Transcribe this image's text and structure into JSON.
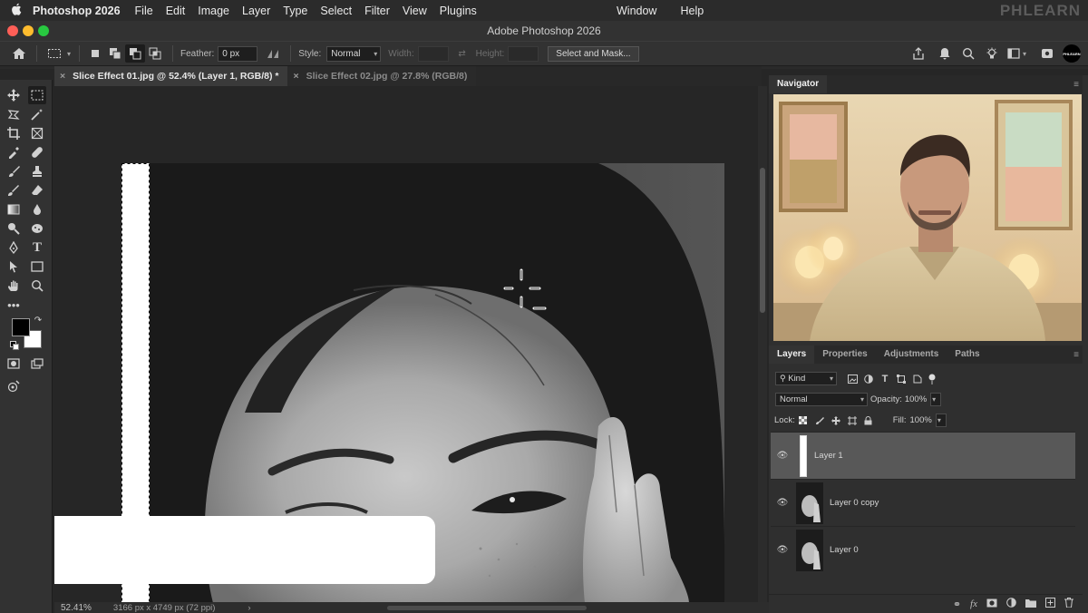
{
  "menubar": {
    "app_name": "Photoshop 2026",
    "items": [
      "File",
      "Edit",
      "Image",
      "Layer",
      "Type",
      "Select",
      "Filter",
      "View",
      "Plugins"
    ],
    "right_items": [
      "Window",
      "Help"
    ],
    "watermark": "PHLEARN"
  },
  "titlebar": {
    "title": "Adobe Photoshop 2026"
  },
  "options": {
    "feather_label": "Feather:",
    "feather_value": "0 px",
    "style_label": "Style:",
    "style_value": "Normal",
    "width_label": "Width:",
    "height_label": "Height:",
    "select_mask_label": "Select and Mask..."
  },
  "tabs": [
    {
      "label": "Slice Effect 01.jpg @ 52.4% (Layer 1, RGB/8) *",
      "active": true
    },
    {
      "label": "Slice Effect 02.jpg @ 27.8% (RGB/8)",
      "active": false
    }
  ],
  "status": {
    "zoom": "52.41%",
    "doc_info": "3166 px x 4749 px (72 ppi)"
  },
  "navigator": {
    "title": "Navigator"
  },
  "layers_panel": {
    "tabs": [
      "Layers",
      "Properties",
      "Adjustments",
      "Paths"
    ],
    "filter_kind": "Kind",
    "blend_mode": "Normal",
    "opacity_label": "Opacity:",
    "opacity_value": "100%",
    "lock_label": "Lock:",
    "fill_label": "Fill:",
    "fill_value": "100%",
    "layers": [
      {
        "name": "Layer 1",
        "active": true
      },
      {
        "name": "Layer 0 copy",
        "active": false
      },
      {
        "name": "Layer 0",
        "active": false
      }
    ]
  },
  "colors": {
    "accent_foreground": "#000000",
    "background_swatch": "#ffffff"
  }
}
